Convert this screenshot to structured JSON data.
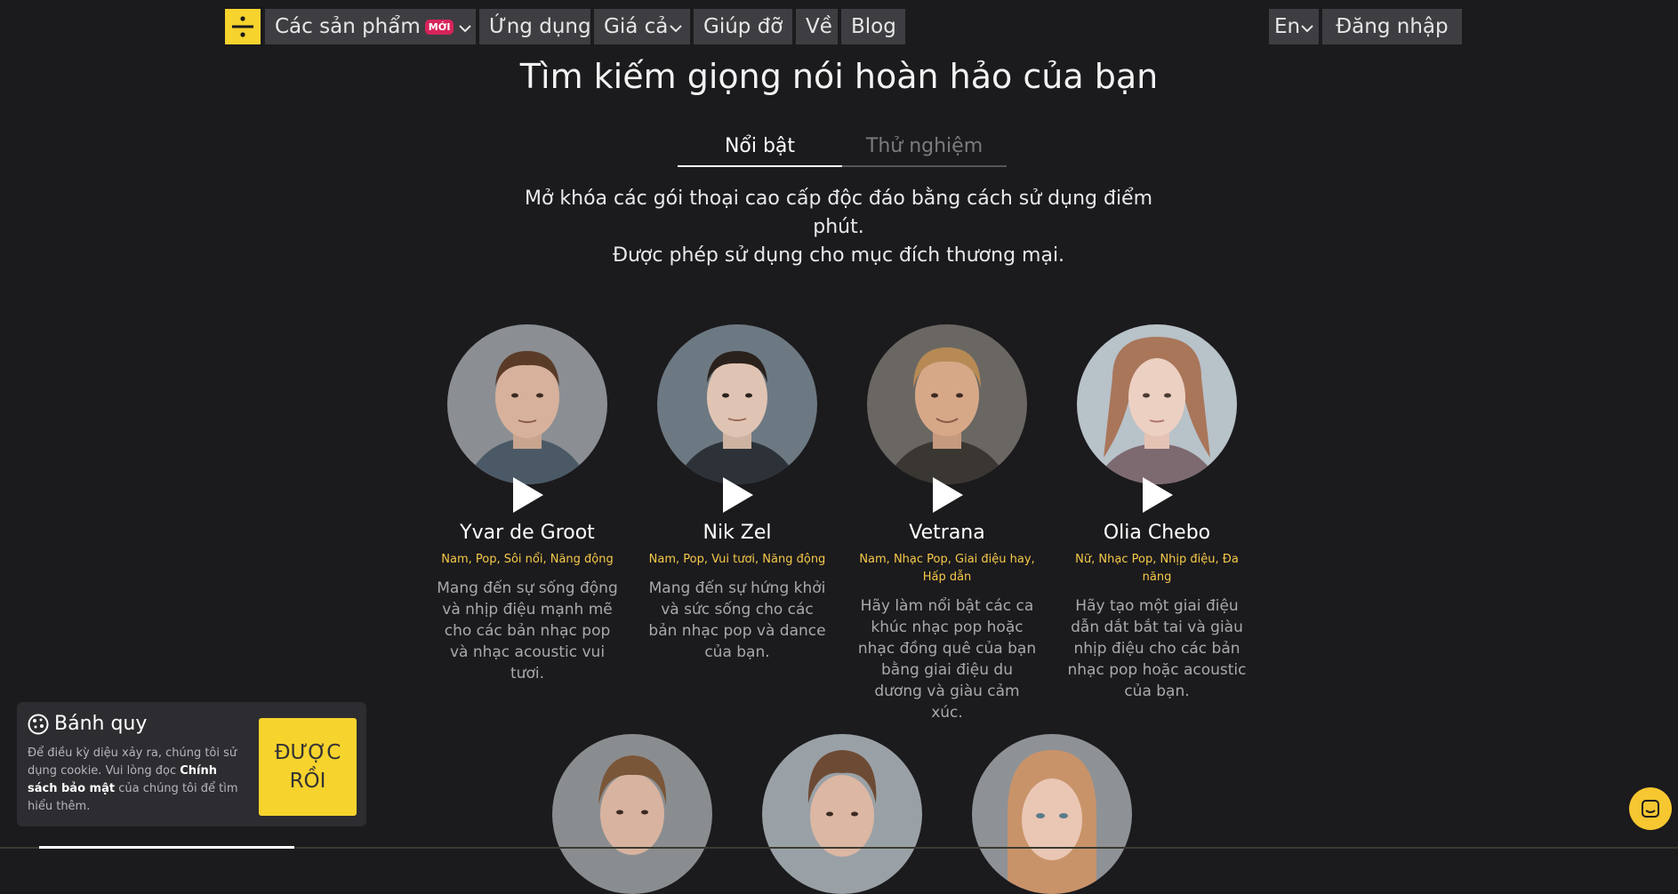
{
  "nav": {
    "products": "Các sản phẩm",
    "new_badge": "MỚI",
    "apps": "Ứng dụng",
    "pricing": "Giá cả",
    "help": "Giúp đỡ",
    "about": "Về",
    "blog": "Blog",
    "language": "En",
    "login": "Đăng nhập"
  },
  "page": {
    "title": "Tìm kiếm giọng nói hoàn hảo của bạn",
    "tab_featured": "Nổi bật",
    "tab_experimental": "Thử nghiệm",
    "desc_line1": "Mở khóa các gói thoại cao cấp độc đáo bằng cách sử dụng điểm phút.",
    "desc_line2": "Được phép sử dụng cho mục đích thương mại."
  },
  "voices": [
    {
      "name": "Yvar de Groot",
      "tags": "Nam, Pop, Sôi nổi, Năng động",
      "blurb": "Mang đến sự sống động và nhịp điệu mạnh mẽ cho các bản nhạc pop và nhạc acoustic vui tươi."
    },
    {
      "name": "Nik Zel",
      "tags": "Nam, Pop, Vui tươi, Năng động",
      "blurb": "Mang đến sự hứng khởi và sức sống cho các bản nhạc pop và dance của bạn."
    },
    {
      "name": "Vetrana",
      "tags": "Nam, Nhạc Pop, Giai điệu hay, Hấp dẫn",
      "blurb": "Hãy làm nổi bật các ca khúc nhạc pop hoặc nhạc đồng quê của bạn bằng giai điệu du dương và giàu cảm xúc."
    },
    {
      "name": "Olia Chebo",
      "tags": "Nữ, Nhạc Pop, Nhịp điệu, Đa năng",
      "blurb": "Hãy tạo một giai điệu dẫn dắt bắt tai và giàu nhịp điệu cho các bản nhạc pop hoặc acoustic của bạn."
    }
  ],
  "cookie": {
    "title": "Bánh quy",
    "text_before": "Để điều kỳ diệu xảy ra, chúng tôi sử dụng cookie. Vui lòng đọc ",
    "policy_link": "Chính sách bảo mật",
    "text_after": " của chúng tôi để tìm hiểu thêm.",
    "accept": "ĐƯỢC RỒI"
  },
  "colors": {
    "background": "#1b1a1d",
    "accent_yellow": "#f6d32d",
    "tag_yellow": "#f6c94a",
    "badge_red": "#d6245a"
  },
  "icons": [
    "divide-logo-icon",
    "chevron-down-icon",
    "play-icon",
    "cookie-icon",
    "chat-icon"
  ]
}
